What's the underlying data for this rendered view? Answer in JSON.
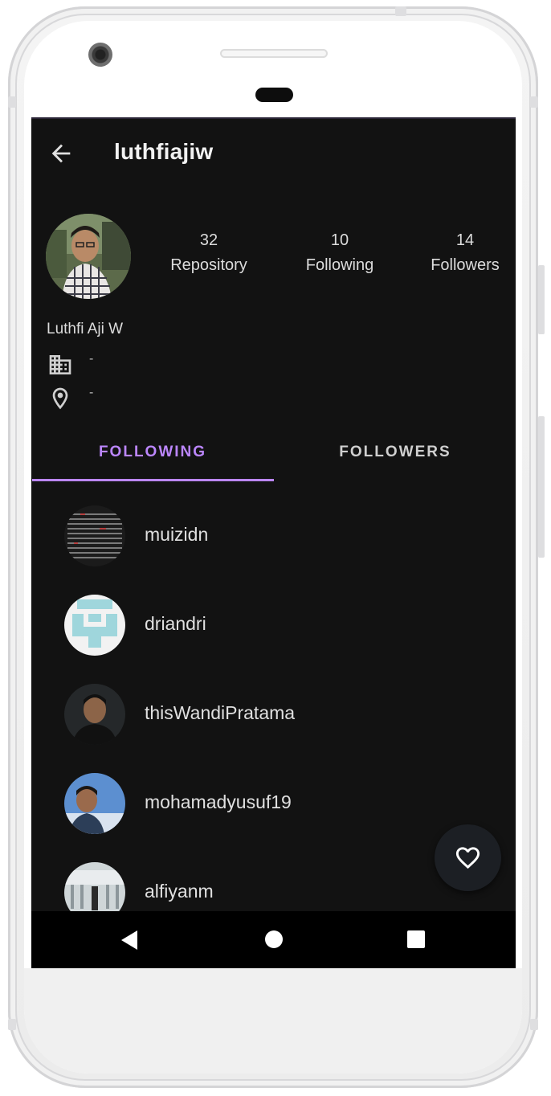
{
  "app": {
    "title": "luthfiajiw",
    "accent_color": "#bb86fc",
    "background_color": "#121212"
  },
  "profile": {
    "name": "Luthfi Aji W",
    "company": "-",
    "location": "-",
    "stats": [
      {
        "value": "32",
        "label": "Repository"
      },
      {
        "value": "10",
        "label": "Following"
      },
      {
        "value": "14",
        "label": "Followers"
      }
    ]
  },
  "tabs": [
    {
      "label": "FOLLOWING",
      "selected": true
    },
    {
      "label": "FOLLOWERS",
      "selected": false
    }
  ],
  "users": [
    {
      "login": "muizidn"
    },
    {
      "login": "driandri"
    },
    {
      "login": "thisWandiPratama"
    },
    {
      "login": "mohamadyusuf19"
    },
    {
      "login": "alfiyanm"
    }
  ],
  "icons": {
    "back": "arrow-left-icon",
    "company": "building-icon",
    "location": "location-pin-icon",
    "fab": "heart-outline-icon"
  }
}
